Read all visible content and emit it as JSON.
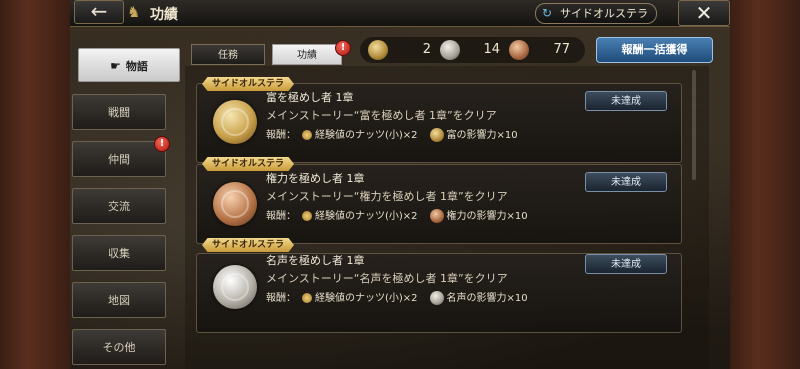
{
  "header": {
    "back_icon": "←",
    "title_icon": "♞",
    "title": "功績",
    "profile_icon": "↻",
    "profile_name": "サイドオルステラ",
    "close_icon": "✕"
  },
  "nav": {
    "items": [
      {
        "label": "物語",
        "active": true,
        "icon": "☛"
      },
      {
        "label": "戦闘"
      },
      {
        "label": "仲間",
        "badge": "!"
      },
      {
        "label": "交流"
      },
      {
        "label": "収集"
      },
      {
        "label": "地図"
      },
      {
        "label": "その他"
      }
    ]
  },
  "subtabs": [
    {
      "label": "任務"
    },
    {
      "label": "功績",
      "active": true,
      "badge": "!"
    }
  ],
  "counters": {
    "gold": "2",
    "silver": "14",
    "bronze": "77"
  },
  "claim_all_label": "報酬一括獲得",
  "cards": [
    {
      "tag": "サイドオルステラ",
      "title": "富を極めし者 1章",
      "desc": "メインストーリー“富を極めし者 1章”をクリア",
      "reward_label": "報酬：",
      "reward_item": "経験値のナッツ(小)×2",
      "influence": "富の影響力×10",
      "status": "未達成",
      "medal": "gold"
    },
    {
      "tag": "サイドオルステラ",
      "title": "権力を極めし者 1章",
      "desc": "メインストーリー“権力を極めし者 1章”をクリア",
      "reward_label": "報酬：",
      "reward_item": "経験値のナッツ(小)×2",
      "influence": "権力の影響力×10",
      "status": "未達成",
      "medal": "bronze"
    },
    {
      "tag": "サイドオルステラ",
      "title": "名声を極めし者 1章",
      "desc": "メインストーリー“名声を極めし者 1章”をクリア",
      "reward_label": "報酬：",
      "reward_item": "経験値のナッツ(小)×2",
      "influence": "名声の影響力×10",
      "status": "未達成",
      "medal": "silver"
    }
  ]
}
